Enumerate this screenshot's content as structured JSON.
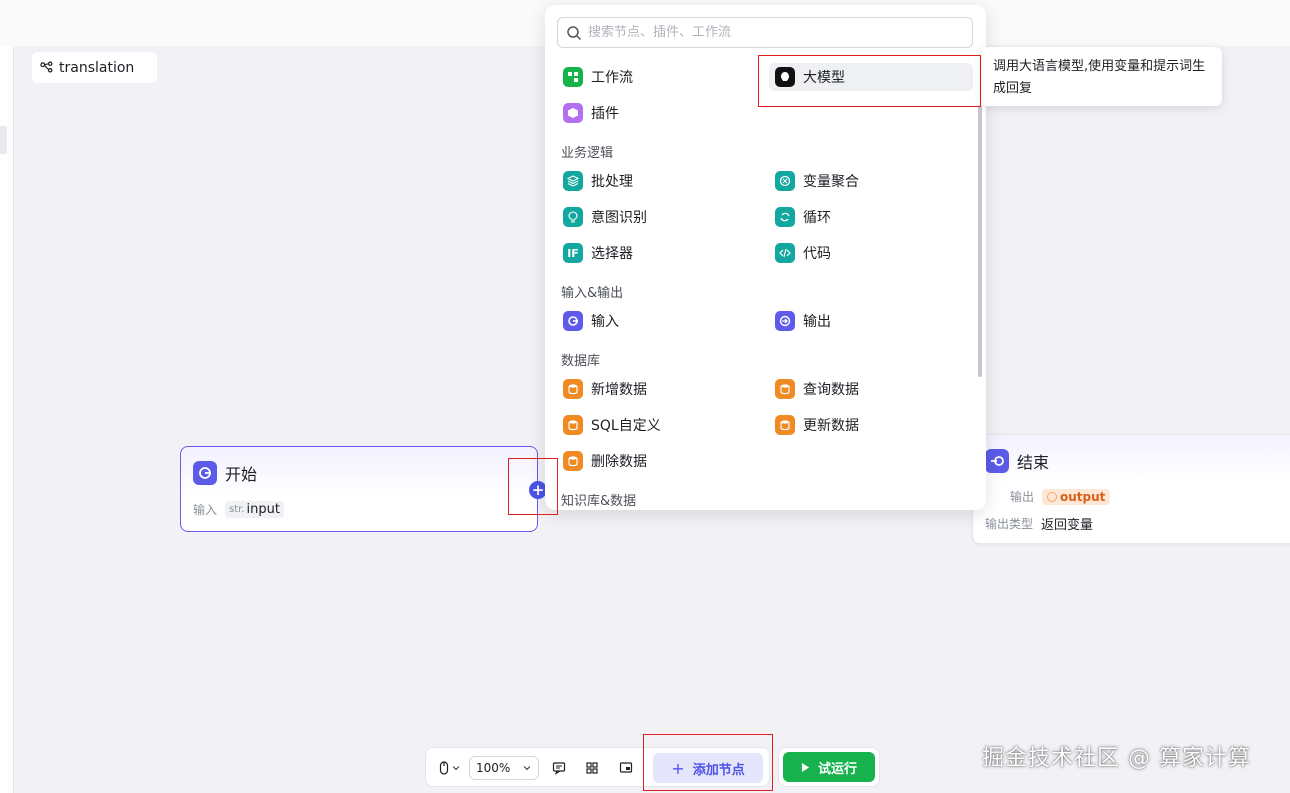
{
  "canvas": {
    "flow_tag": "translation"
  },
  "start_node": {
    "title": "开始",
    "input_label": "输入",
    "param_type": "str.",
    "param_name": "input"
  },
  "end_node": {
    "title": "结束",
    "output_label": "输出",
    "output_value": "output",
    "output_type_label": "输出类型",
    "output_type_value": "返回变量"
  },
  "node_menu": {
    "search_placeholder": "搜索节点、插件、工作流",
    "top_items": [
      {
        "label": "工作流",
        "icon": "workflow-icon"
      },
      {
        "label": "大模型",
        "icon": "llm-icon"
      },
      {
        "label": "插件",
        "icon": "plugin-icon"
      }
    ],
    "sections": [
      {
        "title": "业务逻辑",
        "items": [
          {
            "label": "批处理",
            "icon": "batch-icon"
          },
          {
            "label": "变量聚合",
            "icon": "variable-merge-icon"
          },
          {
            "label": "意图识别",
            "icon": "intent-icon"
          },
          {
            "label": "循环",
            "icon": "loop-icon"
          },
          {
            "label": "选择器",
            "icon": "selector-icon"
          },
          {
            "label": "代码",
            "icon": "code-icon"
          }
        ]
      },
      {
        "title": "输入&输出",
        "items": [
          {
            "label": "输入",
            "icon": "input-icon"
          },
          {
            "label": "输出",
            "icon": "output-icon"
          }
        ]
      },
      {
        "title": "数据库",
        "items": [
          {
            "label": "新增数据",
            "icon": "db-insert-icon"
          },
          {
            "label": "查询数据",
            "icon": "db-query-icon"
          },
          {
            "label": "SQL自定义",
            "icon": "db-sql-icon"
          },
          {
            "label": "更新数据",
            "icon": "db-update-icon"
          },
          {
            "label": "删除数据",
            "icon": "db-delete-icon"
          }
        ]
      },
      {
        "title": "知识库&数据",
        "items": []
      }
    ]
  },
  "tooltip": {
    "text": "调用大语言模型,使用变量和提示词生成回复"
  },
  "toolbar": {
    "zoom": "100%",
    "add_node_label": "添加节点",
    "run_label": "试运行"
  },
  "watermark": "掘金技术社区 @ 算家计算",
  "colors": {
    "accent": "#4d53e8",
    "run_green": "#17b14d",
    "highlight_red": "#e02020"
  }
}
